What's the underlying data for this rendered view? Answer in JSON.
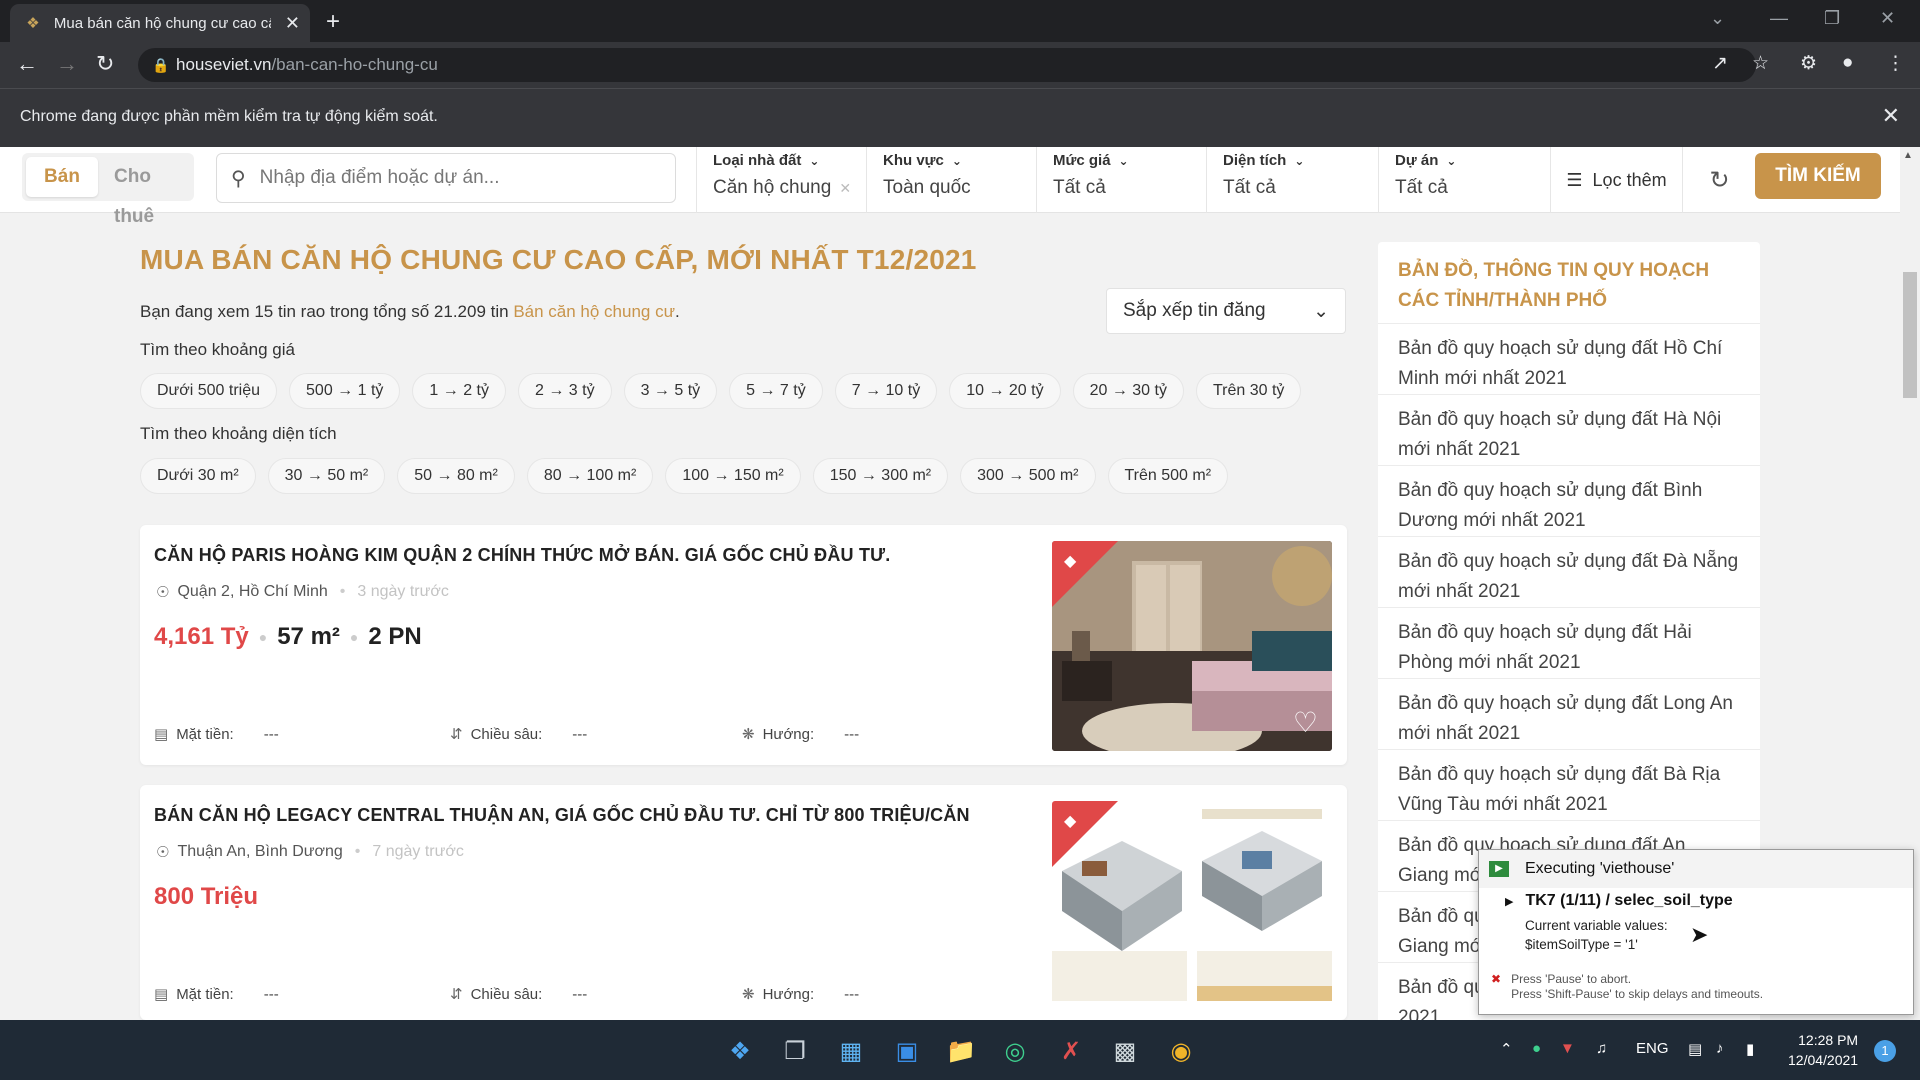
{
  "browser": {
    "tab_title": "Mua bán căn hộ chung cư cao cấ",
    "url_host": "houseviet.vn",
    "url_path": "/ban-can-ho-chung-cu",
    "infobar_message": "Chrome đang được phần mềm kiểm tra tự động kiểm soát."
  },
  "search": {
    "tab_sell": "Bán",
    "tab_rent": "Cho thuê",
    "placeholder": "Nhập địa điểm hoặc dự án...",
    "filters": [
      {
        "label": "Loại nhà đất",
        "value": "Căn hộ chung"
      },
      {
        "label": "Khu vực",
        "value": "Toàn quốc"
      },
      {
        "label": "Mức giá",
        "value": "Tất cả"
      },
      {
        "label": "Diện tích",
        "value": "Tất cả"
      },
      {
        "label": "Dự án",
        "value": "Tất cả"
      }
    ],
    "more_filters": "Lọc thêm",
    "search_button": "TÌM KIẾM"
  },
  "main": {
    "title": "MUA BÁN CĂN HỘ CHUNG CƯ CAO CẤP, MỚI NHẤT T12/2021",
    "summary_prefix": "Bạn đang xem 15 tin rao trong tổng số 21.209 tin ",
    "summary_link": "Bán căn hộ chung cư",
    "summary_suffix": ".",
    "sort_label": "Sắp xếp tin đăng",
    "price_group_label": "Tìm theo khoảng giá",
    "price_ranges": [
      "Dưới 500 triệu",
      "500 → 1 tỷ",
      "1 → 2 tỷ",
      "2 → 3 tỷ",
      "3 → 5 tỷ",
      "5 → 7 tỷ",
      "7 → 10 tỷ",
      "10 → 20 tỷ",
      "20 → 30 tỷ",
      "Trên 30 tỷ"
    ],
    "area_group_label": "Tìm theo khoảng diện tích",
    "area_ranges": [
      "Dưới 30 m²",
      "30 → 50 m²",
      "50 → 80 m²",
      "80 → 100 m²",
      "100 → 150 m²",
      "150 → 300 m²",
      "300 → 500 m²",
      "Trên 500 m²"
    ]
  },
  "listings": [
    {
      "title": "CĂN HỘ PARIS HOÀNG KIM QUẬN 2 CHÍNH THỨC MỞ BÁN. GIÁ GỐC CHỦ ĐẦU TƯ.",
      "location": "Quận 2, Hồ Chí Minh",
      "posted": "3 ngày trước",
      "price": "4,161 Tỷ",
      "area": "57 m²",
      "bedrooms": "2 PN",
      "frontage_label": "Mặt tiền:",
      "frontage_value": "---",
      "depth_label": "Chiều sâu:",
      "depth_value": "---",
      "direction_label": "Hướng:",
      "direction_value": "---"
    },
    {
      "title": "BÁN CĂN HỘ LEGACY CENTRAL THUẬN AN, GIÁ GỐC CHỦ ĐẦU TƯ. CHỈ TỪ 800 TRIỆU/CĂN",
      "location": "Thuận An, Bình Dương",
      "posted": "7 ngày trước",
      "price": "800 Triệu",
      "frontage_label": "Mặt tiền:",
      "frontage_value": "---",
      "depth_label": "Chiều sâu:",
      "depth_value": "---",
      "direction_label": "Hướng:",
      "direction_value": "---"
    }
  ],
  "sidebar": {
    "title": "BẢN ĐỒ, THÔNG TIN QUY HOẠCH CÁC TỈNH/THÀNH PHỐ",
    "items": [
      "Bản đồ quy hoạch sử dụng đất Hồ Chí Minh mới nhất 2021",
      "Bản đồ quy hoạch sử dụng đất Hà Nội mới nhất 2021",
      "Bản đồ quy hoạch sử dụng đất Bình Dương mới nhất 2021",
      "Bản đồ quy hoạch sử dụng đất Đà Nẵng mới nhất 2021",
      "Bản đồ quy hoạch sử dụng đất Hải Phòng mới nhất 2021",
      "Bản đồ quy hoạch sử dụng đất Long An mới nhất 2021",
      "Bản đồ quy hoạch sử dụng đất Bà Rịa Vũng Tàu mới nhất 2021",
      "Bản đồ quy hoạch sử dụng đất An Giang mới nhất 2021",
      "Bản đồ quy hoạch sử dụng đất An Giang mới nhất 2021",
      "Bản đồ quy hoạch sử dụng đất mới nhất 2021"
    ]
  },
  "automation_popup": {
    "title": "Executing 'viethouse'",
    "step": "TK7 (1/11) / selec_soil_type",
    "vars_label": "Current variable values:",
    "vars_value": "$itemSoilType = '1'",
    "hint1": "Press 'Pause' to abort.",
    "hint2": "Press 'Shift-Pause' to skip delays and timeouts."
  },
  "taskbar": {
    "lang": "ENG",
    "time": "12:28 PM",
    "date": "12/04/2021",
    "notifications": "1"
  },
  "colors": {
    "brand": "#c8944a",
    "price": "#e04848",
    "chrome_dark": "#202124",
    "taskbar": "#1f2a36"
  }
}
